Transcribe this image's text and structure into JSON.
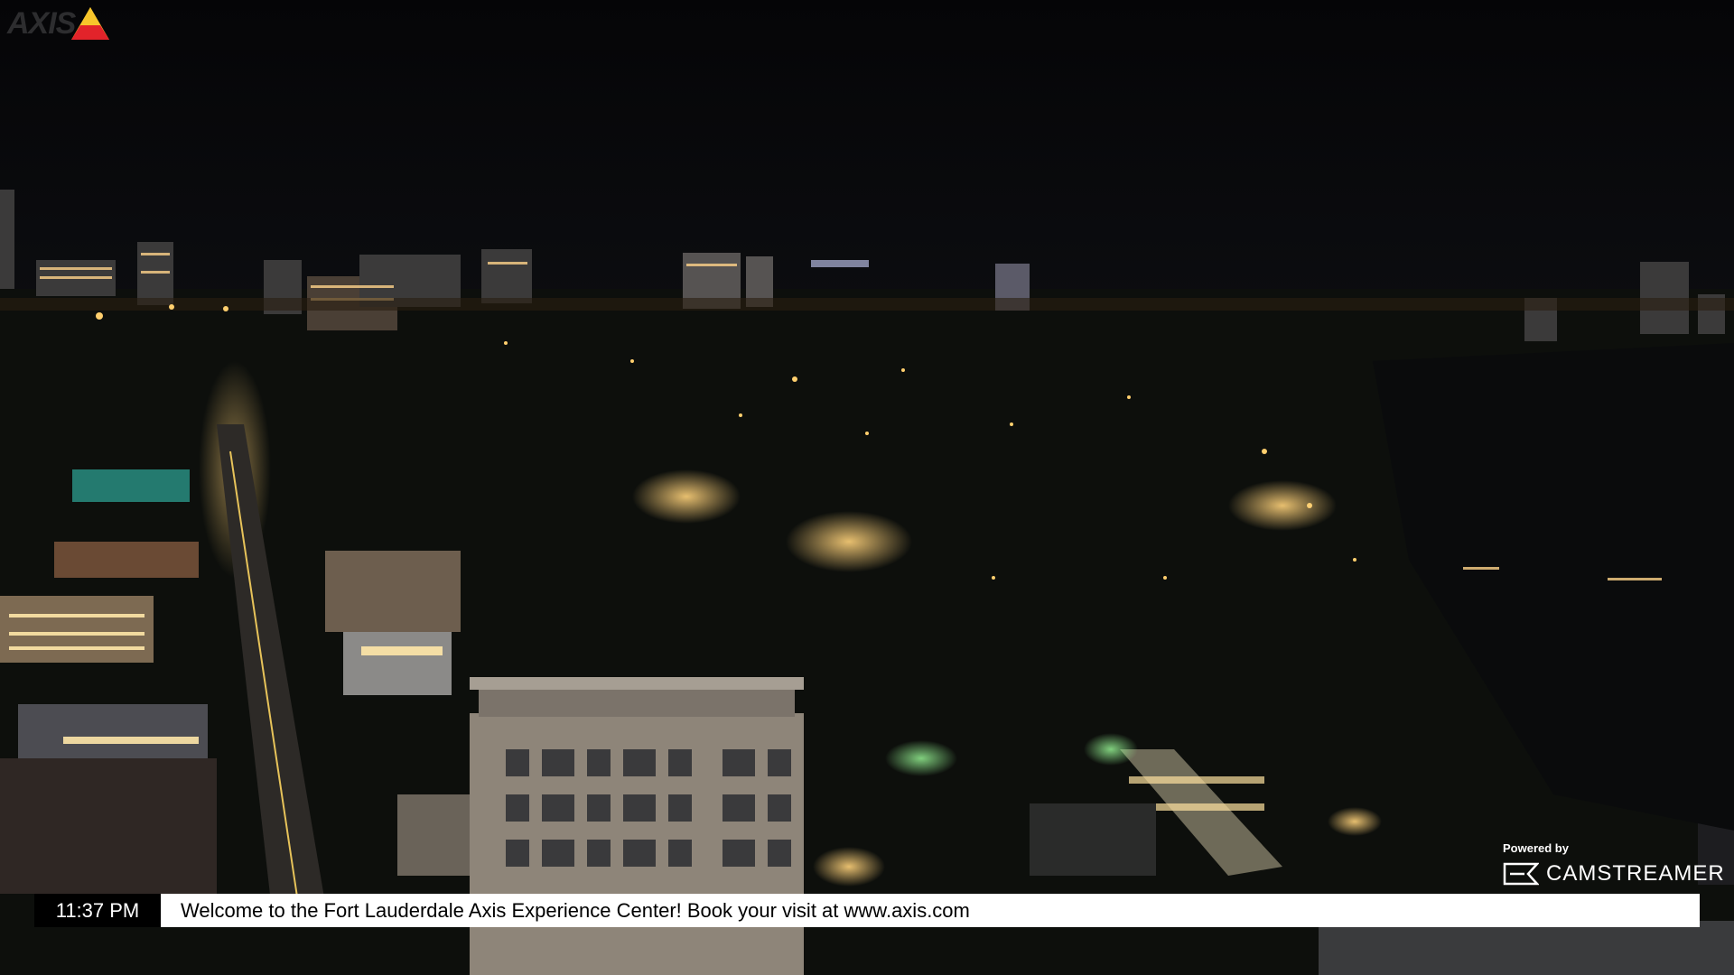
{
  "overlay": {
    "brand_text": "AXIS",
    "powered_by": "Powered by",
    "partner_name": "CAMSTREAMER",
    "time": "11:37 PM",
    "message": "Welcome to the Fort Lauderdale Axis Experience Center! Book your visit at www.axis.com"
  },
  "colors": {
    "sky": "#070709",
    "logo_triangle_top": "#f7c52b",
    "logo_triangle_bottom": "#e2232a",
    "ticker_time_bg": "#000000",
    "ticker_msg_bg": "#ffffff"
  },
  "icons": [
    "axis-logo-triangle-icon",
    "camstreamer-logo-icon"
  ]
}
